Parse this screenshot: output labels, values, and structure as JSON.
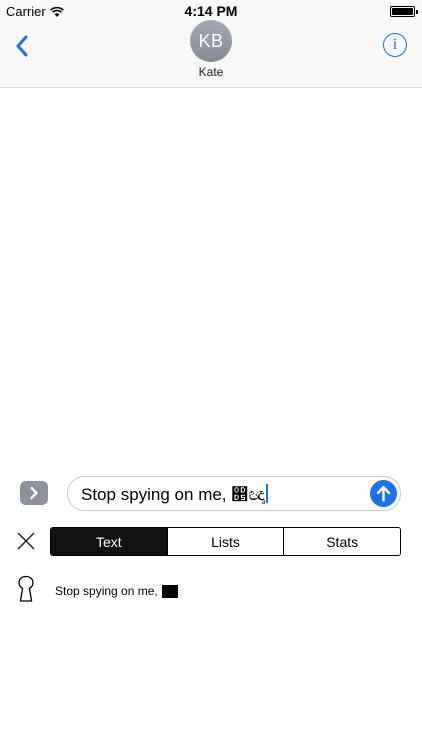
{
  "status_bar": {
    "carrier": "Carrier",
    "time": "4:14 PM",
    "battery_level": 1.0
  },
  "header": {
    "avatar_initials": "KB",
    "contact_name": "Kate",
    "back_icon": "chevron-left-icon",
    "info_icon": "info-circle-icon",
    "info_glyph": "i"
  },
  "composer": {
    "message_text": "Stop spying on me, ෕ඥෘ",
    "expand_icon": "chevron-right-icon",
    "send_icon": "arrow-up-icon"
  },
  "tabs": [
    {
      "label": "Text",
      "active": true
    },
    {
      "label": "Lists",
      "active": false
    },
    {
      "label": "Stats",
      "active": false
    }
  ],
  "preview": {
    "text": "Stop spying on me,",
    "icon": "keyhole-icon"
  },
  "colors": {
    "accent": "#1a73e8",
    "nav_background": "#f8f8f8",
    "avatar": "#8f939c",
    "active_tab": "#111111"
  }
}
